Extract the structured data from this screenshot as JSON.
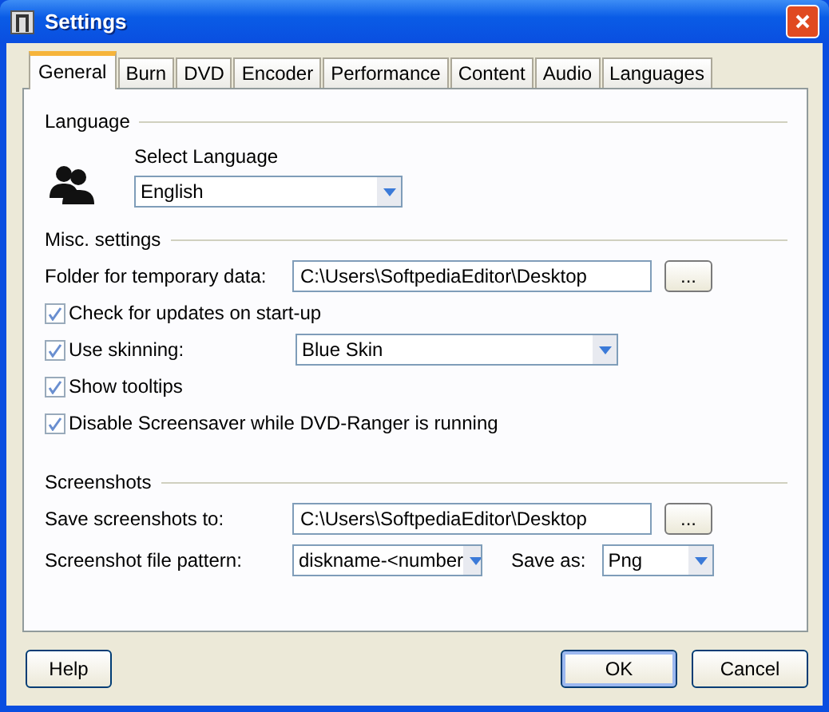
{
  "window": {
    "title": "Settings"
  },
  "tabs": [
    {
      "label": "General",
      "selected": true
    },
    {
      "label": "Burn",
      "selected": false
    },
    {
      "label": "DVD",
      "selected": false
    },
    {
      "label": "Encoder",
      "selected": false
    },
    {
      "label": "Performance",
      "selected": false
    },
    {
      "label": "Content",
      "selected": false
    },
    {
      "label": "Audio",
      "selected": false
    },
    {
      "label": "Languages",
      "selected": false
    }
  ],
  "language": {
    "title": "Language",
    "label": "Select Language",
    "value": "English"
  },
  "misc": {
    "title": "Misc. settings",
    "folder_label": "Folder for temporary data:",
    "folder_value": "C:\\Users\\SoftpediaEditor\\Desktop",
    "browse": "...",
    "options": [
      {
        "kind": "checkbox",
        "label": "Check for updates on start-up",
        "checked": true
      },
      {
        "kind": "checkbox-select",
        "label": "Use skinning:",
        "checked": true,
        "value": "Blue Skin"
      },
      {
        "kind": "checkbox",
        "label": "Show tooltips",
        "checked": true
      },
      {
        "kind": "checkbox",
        "label": "Disable Screensaver while DVD-Ranger is running",
        "checked": true
      }
    ]
  },
  "screenshots": {
    "title": "Screenshots",
    "save_label": "Save screenshots to:",
    "save_value": "C:\\Users\\SoftpediaEditor\\Desktop",
    "browse": "...",
    "pattern_label": "Screenshot file pattern:",
    "pattern_value": "diskname-<number",
    "save_as_label": "Save as:",
    "save_as_value": "Png"
  },
  "buttons": [
    {
      "label": "Help",
      "kind": "left"
    },
    {
      "label": "OK",
      "kind": "default"
    },
    {
      "label": "Cancel",
      "kind": "normal"
    }
  ]
}
